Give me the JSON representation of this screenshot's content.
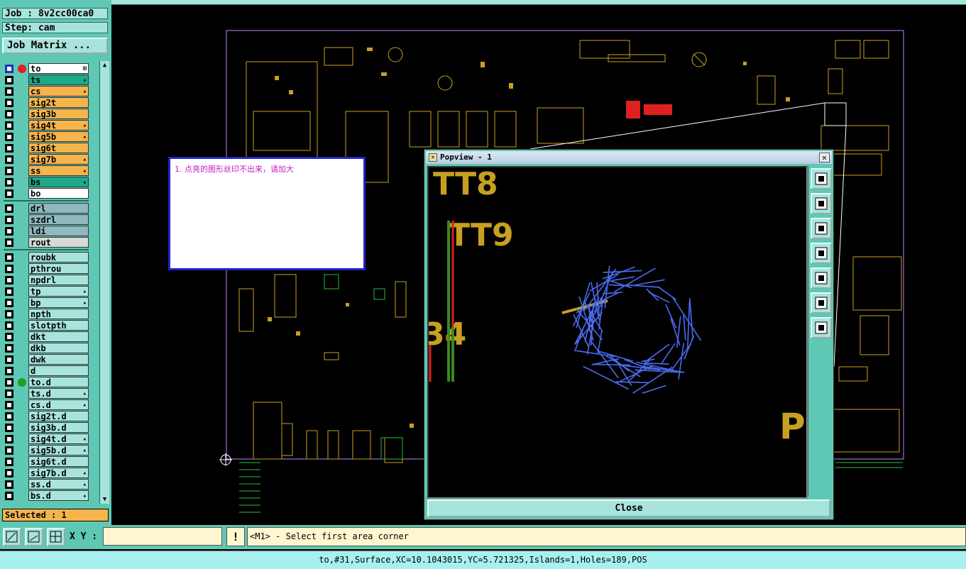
{
  "job": {
    "label": "Job : 8v2cc00ca0",
    "step": "Step: cam",
    "matrix_button": "Job Matrix ..."
  },
  "layers": [
    {
      "name": "to",
      "color": "#ffffff",
      "flag": "⊞"
    },
    {
      "name": "ts",
      "color": "#1fa88a",
      "flag": "▴"
    },
    {
      "name": "cs",
      "color": "#f6b44b",
      "flag": "▴"
    },
    {
      "name": "sig2t",
      "color": "#f6b44b",
      "flag": ""
    },
    {
      "name": "sig3b",
      "color": "#f6b44b",
      "flag": ""
    },
    {
      "name": "sig4t",
      "color": "#f6b44b",
      "flag": "▴"
    },
    {
      "name": "sig5b",
      "color": "#f6b44b",
      "flag": "▴"
    },
    {
      "name": "sig6t",
      "color": "#f6b44b",
      "flag": ""
    },
    {
      "name": "sig7b",
      "color": "#f6b44b",
      "flag": "▴"
    },
    {
      "name": "ss",
      "color": "#f6b44b",
      "flag": "▴"
    },
    {
      "name": "bs",
      "color": "#1fa88a",
      "flag": "▴"
    },
    {
      "name": "bo",
      "color": "#ffffff",
      "flag": ""
    },
    {
      "name": "drl",
      "color": "#8fb8c0",
      "flag": ""
    },
    {
      "name": "szdrl",
      "color": "#8fb8c0",
      "flag": ""
    },
    {
      "name": "ldi",
      "color": "#8fb8c0",
      "flag": ""
    },
    {
      "name": "rout",
      "color": "#d8d8d8",
      "flag": ""
    },
    {
      "name": "roubk",
      "color": "#a8e4dc",
      "flag": ""
    },
    {
      "name": "pthrou",
      "color": "#a8e4dc",
      "flag": ""
    },
    {
      "name": "npdrl",
      "color": "#a8e4dc",
      "flag": ""
    },
    {
      "name": "tp",
      "color": "#a8e4dc",
      "flag": "▴"
    },
    {
      "name": "bp",
      "color": "#a8e4dc",
      "flag": "▴"
    },
    {
      "name": "npth",
      "color": "#a8e4dc",
      "flag": ""
    },
    {
      "name": "slotpth",
      "color": "#a8e4dc",
      "flag": ""
    },
    {
      "name": "dkt",
      "color": "#a8e4dc",
      "flag": ""
    },
    {
      "name": "dkb",
      "color": "#a8e4dc",
      "flag": ""
    },
    {
      "name": "dwk",
      "color": "#a8e4dc",
      "flag": ""
    },
    {
      "name": "d",
      "color": "#a8e4dc",
      "flag": ""
    },
    {
      "name": "to.d",
      "color": "#a8e4dc",
      "flag": ""
    },
    {
      "name": "ts.d",
      "color": "#a8e4dc",
      "flag": "▴"
    },
    {
      "name": "cs.d",
      "color": "#a8e4dc",
      "flag": "▴"
    },
    {
      "name": "sig2t.d",
      "color": "#a8e4dc",
      "flag": ""
    },
    {
      "name": "sig3b.d",
      "color": "#a8e4dc",
      "flag": ""
    },
    {
      "name": "sig4t.d",
      "color": "#a8e4dc",
      "flag": "▴"
    },
    {
      "name": "sig5b.d",
      "color": "#a8e4dc",
      "flag": "▴"
    },
    {
      "name": "sig6t.d",
      "color": "#a8e4dc",
      "flag": ""
    },
    {
      "name": "sig7b.d",
      "color": "#a8e4dc",
      "flag": "▴"
    },
    {
      "name": "ss.d",
      "color": "#a8e4dc",
      "flag": "▴"
    },
    {
      "name": "bs.d",
      "color": "#a8e4dc",
      "flag": "▴"
    }
  ],
  "selected": "Selected : 1",
  "xy_label": "X Y :",
  "xy_value": "",
  "alert": "!",
  "prompt": "<M1> - Select first area corner",
  "status": "to,#31,Surface,XC=10.1043015,YC=5.721325,Islands=1,Holes=189,POS",
  "note": "1. 点亮的图形丝印不出来，请加大",
  "popview": {
    "title": "Popview - 1",
    "close_label": "Close",
    "labels": [
      "TT8",
      "TT9",
      "34",
      "P"
    ],
    "tools": [
      "zoom-home-icon",
      "pan-up-icon",
      "pan-down-icon",
      "pan-left-icon",
      "pan-right-icon",
      "zoom-fit-icon",
      "zoom-center-icon"
    ]
  },
  "colors": {
    "panel": "#5fc8b4",
    "silk": "#c8a020",
    "highlight": "#4a6cf0",
    "board_outline": "#c080ff"
  }
}
